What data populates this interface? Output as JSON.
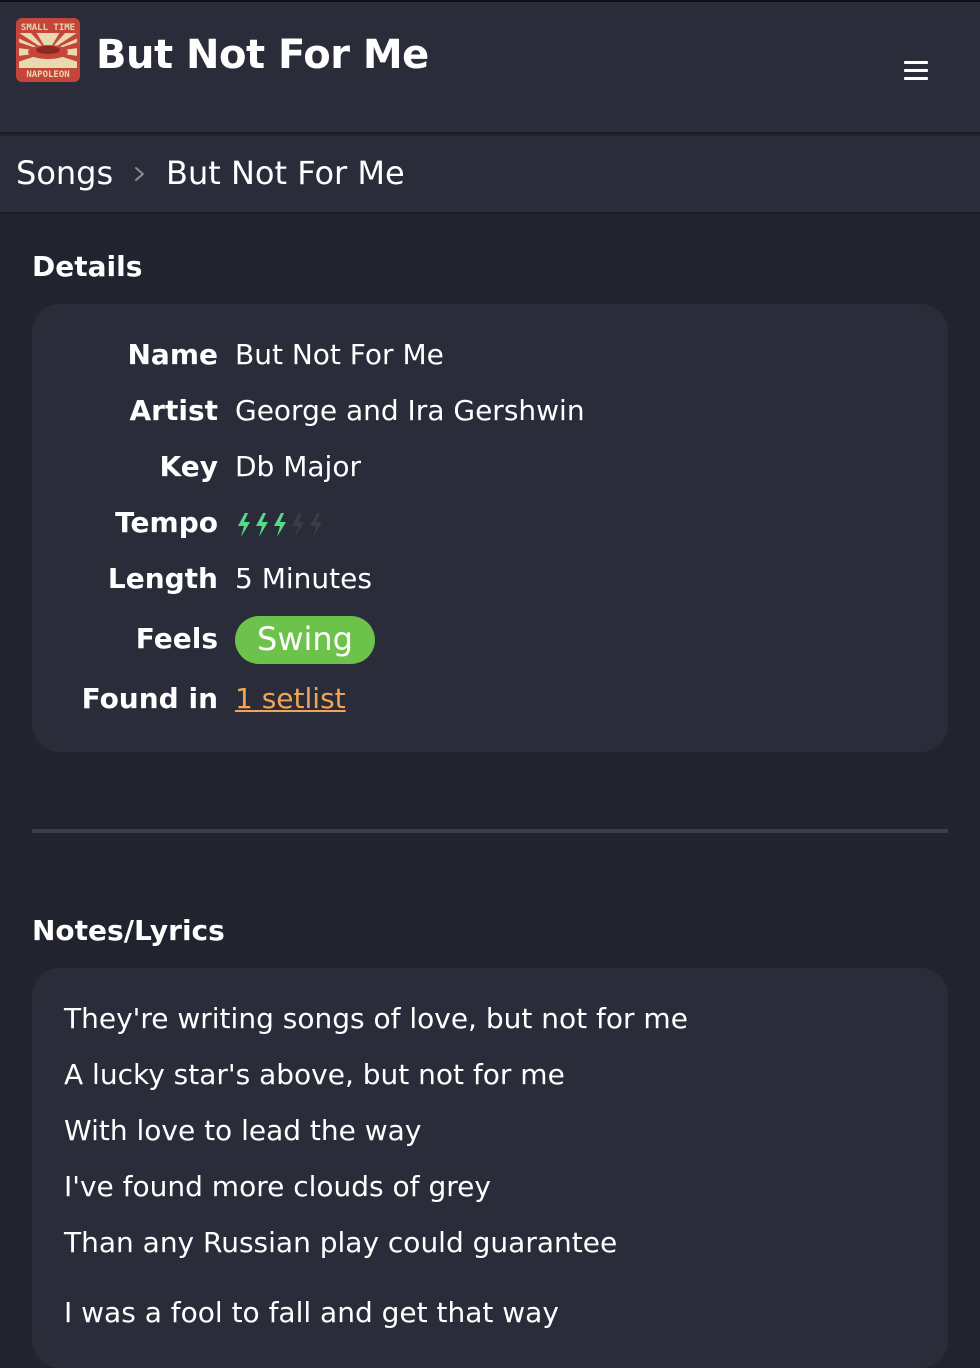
{
  "header": {
    "logo_text_top": "SMALL TIME",
    "logo_text_bottom": "NAPOLEON",
    "title": "But Not For Me"
  },
  "icons": {
    "menu": "hamburger-icon",
    "breadcrumb_separator": "chevron-right-icon",
    "tempo": "lightning-bolt-icon"
  },
  "breadcrumb": {
    "items": [
      "Songs",
      "But Not For Me"
    ]
  },
  "details": {
    "section_title": "Details",
    "name_label": "Name",
    "name": "But Not For Me",
    "artist_label": "Artist",
    "artist": "George and Ira Gershwin",
    "key_label": "Key",
    "key": "Db Major",
    "tempo_label": "Tempo",
    "tempo_rating": 3,
    "tempo_max": 5,
    "length_label": "Length",
    "length": "5 Minutes",
    "feels_label": "Feels",
    "feels": [
      "Swing"
    ],
    "found_in_label": "Found in",
    "found_in": "1 setlist"
  },
  "notes": {
    "section_title": "Notes/Lyrics",
    "lines": [
      "They're writing songs of love, but not for me",
      "A lucky star's above, but not for me",
      "With love to lead the way",
      "I've found more clouds of grey",
      "Than any Russian play could guarantee",
      "I was a fool to fall and get that way"
    ]
  },
  "colors": {
    "background": "#21242e",
    "card": "#2a2d39",
    "tempo_active": "#57d98a",
    "tempo_inactive": "#3a3d48",
    "feel_tag": "#6dc24b",
    "link": "#f0a458"
  }
}
